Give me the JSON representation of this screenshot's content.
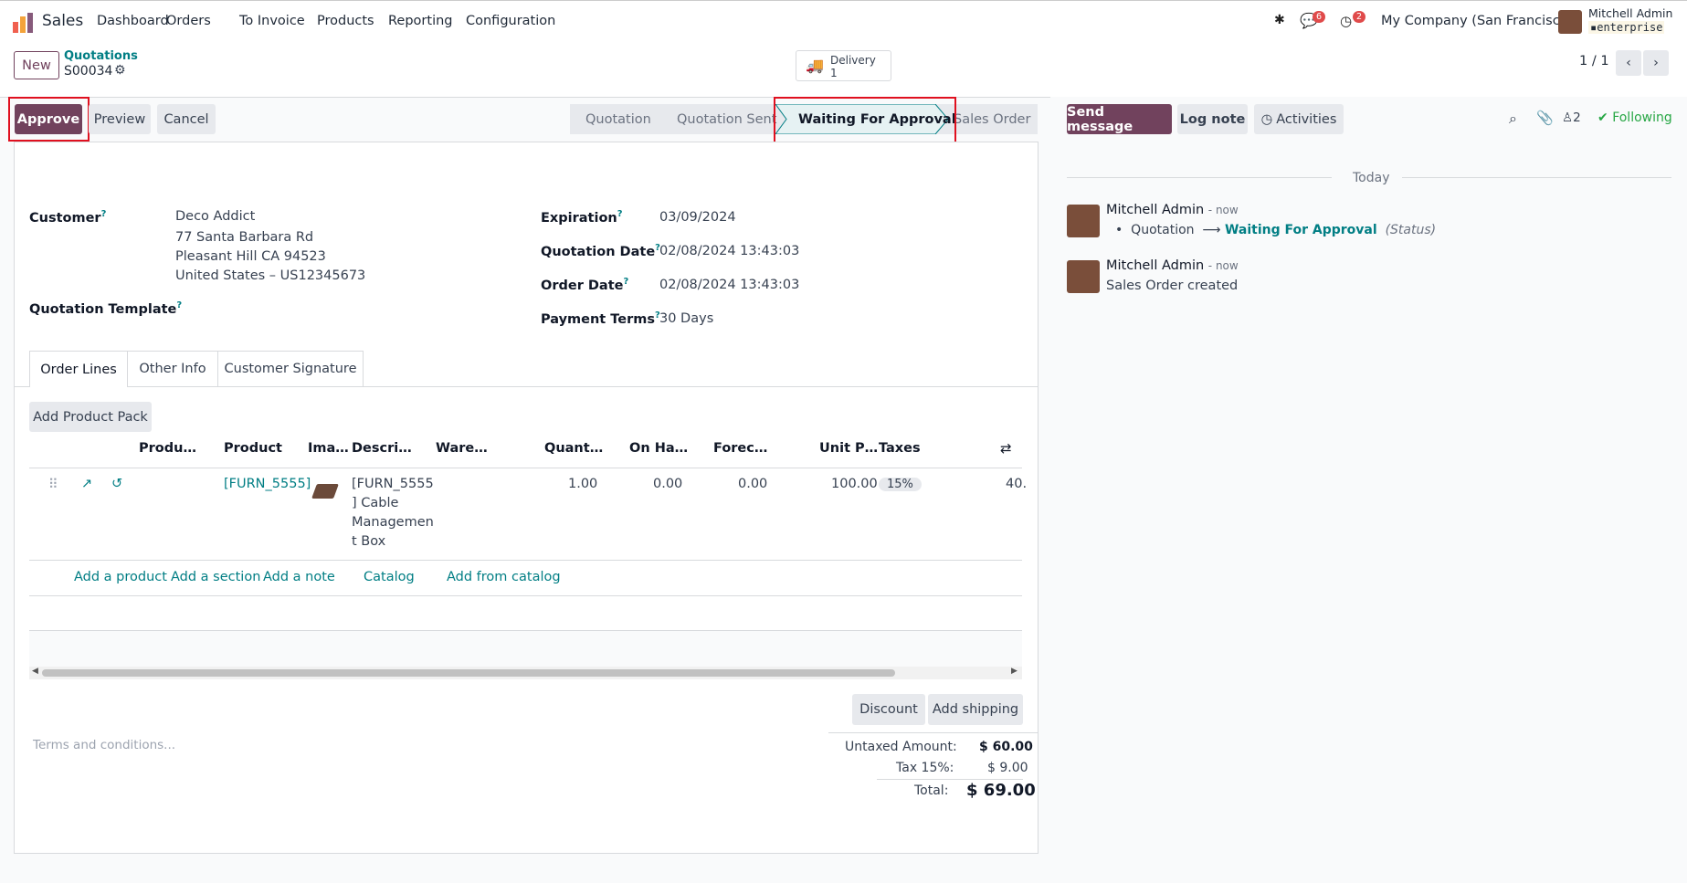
{
  "app": {
    "name": "Sales"
  },
  "menu": [
    "Dashboard",
    "Orders",
    "To Invoice",
    "Products",
    "Reporting",
    "Configuration"
  ],
  "systray": {
    "messages_count": "6",
    "activities_count": "2",
    "company": "My Company (San Francisco)",
    "user_name": "Mitchell Admin",
    "db_name": "enterprise"
  },
  "control": {
    "new_label": "New",
    "breadcrumb_parent": "Quotations",
    "breadcrumb_current": "S00034",
    "smart_button_label": "Delivery",
    "smart_button_count": "1",
    "pager": "1 / 1"
  },
  "actions": {
    "approve": "Approve",
    "preview": "Preview",
    "cancel": "Cancel"
  },
  "status": {
    "stages": [
      "Quotation",
      "Quotation Sent",
      "Waiting For Approval",
      "Sales Order"
    ],
    "current": "Waiting For Approval"
  },
  "form": {
    "customer_label": "Customer",
    "customer_name": "Deco Addict",
    "customer_addr1": "77 Santa Barbara Rd",
    "customer_addr2": "Pleasant Hill CA 94523",
    "customer_addr3": "United States – US12345673",
    "template_label": "Quotation Template",
    "expiration_label": "Expiration",
    "expiration_value": "03/09/2024",
    "quotation_date_label": "Quotation Date",
    "quotation_date_value": "02/08/2024 13:43:03",
    "order_date_label": "Order Date",
    "order_date_value": "02/08/2024 13:43:03",
    "payment_terms_label": "Payment Terms",
    "payment_terms_value": "30 Days"
  },
  "tabs": [
    "Order Lines",
    "Other Info",
    "Customer Signature"
  ],
  "order_lines": {
    "add_pack": "Add Product Pack",
    "columns": [
      "Produ…",
      "Product",
      "Ima…",
      "Descri…",
      "Ware…",
      "Quant…",
      "On Ha…",
      "Forec…",
      "Unit P…",
      "Taxes"
    ],
    "rows": [
      {
        "product": "[FURN_5555]",
        "description_lines": [
          "[FURN_5555",
          "] Cable",
          "Managemen",
          "t Box"
        ],
        "quantity": "1.00",
        "on_hand": "0.00",
        "forecast": "0.00",
        "unit_price": "100.00",
        "tax": "15%",
        "subtotal": "40."
      }
    ],
    "add_links": [
      "Add a product",
      "Add a section",
      "Add a note",
      "Catalog",
      "Add from catalog"
    ]
  },
  "footer": {
    "discount": "Discount",
    "add_shipping": "Add shipping",
    "terms_placeholder": "Terms and conditions...",
    "untaxed_label": "Untaxed Amount:",
    "untaxed_value": "$ 60.00",
    "tax_label": "Tax 15%:",
    "tax_value": "$ 9.00",
    "total_label": "Total:",
    "total_value": "$ 69.00"
  },
  "chatter": {
    "send_message": "Send message",
    "log_note": "Log note",
    "activities": "Activities",
    "followers_count": "2",
    "following": "Following",
    "date_separator": "Today",
    "messages": [
      {
        "author": "Mitchell Admin",
        "time": "- now",
        "old": "Quotation",
        "new": "Waiting For Approval",
        "field": "(Status)"
      },
      {
        "author": "Mitchell Admin",
        "time": "- now",
        "body": "Sales Order created"
      }
    ]
  },
  "colors": {
    "primary": "#71425d",
    "link": "#017e84",
    "highlight": "#e0101f"
  }
}
